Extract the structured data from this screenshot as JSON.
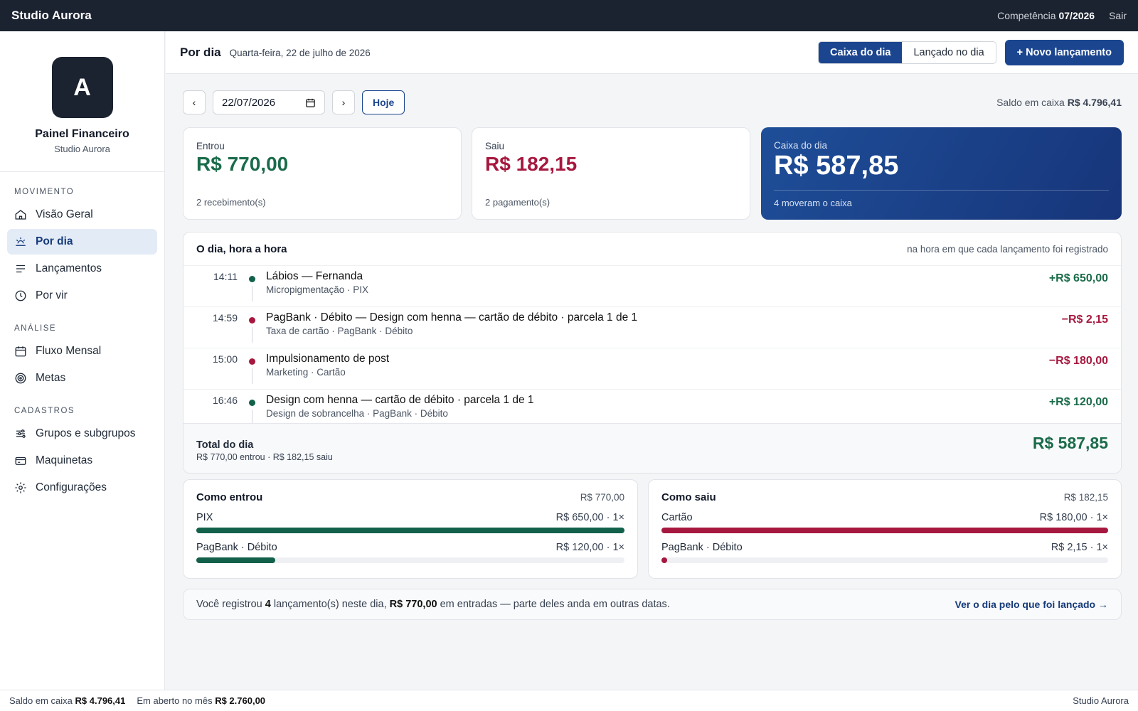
{
  "topbar": {
    "brand": "Studio Aurora",
    "competencia_label": "Competência",
    "competencia_value": "07/2026",
    "logout": "Sair"
  },
  "sidebar": {
    "avatar_letter": "A",
    "profile_name": "Painel Financeiro",
    "profile_sub": "Studio Aurora",
    "sections": [
      {
        "title": "MOVIMENTO",
        "items": [
          {
            "label": "Visão Geral",
            "icon": "home-icon"
          },
          {
            "label": "Por dia",
            "icon": "sunrise-icon",
            "active": true
          },
          {
            "label": "Lançamentos",
            "icon": "list-icon"
          },
          {
            "label": "Por vir",
            "icon": "clock-icon"
          }
        ]
      },
      {
        "title": "ANÁLISE",
        "items": [
          {
            "label": "Fluxo Mensal",
            "icon": "calendar-icon"
          },
          {
            "label": "Metas",
            "icon": "target-icon"
          }
        ]
      },
      {
        "title": "CADASTROS",
        "items": [
          {
            "label": "Grupos e subgrupos",
            "icon": "sliders-icon"
          },
          {
            "label": "Maquinetas",
            "icon": "card-icon"
          },
          {
            "label": "Configurações",
            "icon": "gear-icon"
          }
        ]
      }
    ]
  },
  "header": {
    "title": "Por dia",
    "date": "Quarta-feira, 22 de julho de 2026",
    "seg_caixa": "Caixa do dia",
    "seg_lancado": "Lançado no dia",
    "new_button": "+ Novo lançamento"
  },
  "controls": {
    "prev": "‹",
    "date_value": "22/07/2026",
    "next": "›",
    "today": "Hoje",
    "saldo_label": "Saldo em caixa",
    "saldo_value": "R$ 4.796,41"
  },
  "cards": {
    "entrou": {
      "label": "Entrou",
      "value": "R$ 770,00",
      "foot": "2 recebimento(s)"
    },
    "saiu": {
      "label": "Saiu",
      "value": "R$ 182,15",
      "foot": "2 pagamento(s)"
    },
    "caixa": {
      "label": "Caixa do dia",
      "value": "R$ 587,85",
      "foot": "4 moveram o caixa"
    }
  },
  "timeline": {
    "title": "O dia, hora a hora",
    "note": "na hora em que cada lançamento foi registrado",
    "rows": [
      {
        "time": "14:11",
        "title": "Lábios — Fernanda",
        "sub": "Micropigmentação · PIX",
        "amount": "+R$ 650,00",
        "type": "pos"
      },
      {
        "time": "14:59",
        "title": "PagBank · Débito — Design com henna — cartão de débito · parcela 1 de 1",
        "sub": "Taxa de cartão · PagBank · Débito",
        "amount": "−R$ 2,15",
        "type": "neg"
      },
      {
        "time": "15:00",
        "title": "Impulsionamento de post",
        "sub": "Marketing · Cartão",
        "amount": "−R$ 180,00",
        "type": "neg"
      },
      {
        "time": "16:46",
        "title": "Design com henna — cartão de débito · parcela 1 de 1",
        "sub": "Design de sobrancelha · PagBank · Débito",
        "amount": "+R$ 120,00",
        "type": "pos"
      }
    ],
    "total_title": "Total do dia",
    "total_sub": "R$ 770,00 entrou · R$ 182,15 saiu",
    "total_value": "R$ 587,85"
  },
  "como_entrou": {
    "title": "Como entrou",
    "total": "R$ 770,00",
    "items": [
      {
        "label": "PIX",
        "value": "R$ 650,00 · 1×",
        "fraction": 1.0
      },
      {
        "label": "PagBank · Débito",
        "value": "R$ 120,00 · 1×",
        "fraction": 0.185
      }
    ]
  },
  "como_saiu": {
    "title": "Como saiu",
    "total": "R$ 182,15",
    "items": [
      {
        "label": "Cartão",
        "value": "R$ 180,00 · 1×",
        "fraction": 1.0
      },
      {
        "label": "PagBank · Débito",
        "value": "R$ 2,15 · 1×",
        "fraction": 0.012
      }
    ]
  },
  "info": {
    "text_a": "Você registrou",
    "count": "4",
    "text_b": "lançamento(s) neste dia,",
    "amount": "R$ 770,00",
    "text_c": "em entradas — parte deles anda em outras datas.",
    "link": "Ver o dia pelo que foi lançado →"
  },
  "status": {
    "saldo_label": "Saldo em caixa",
    "saldo_value": "R$ 4.796,41",
    "aberto_label": "Em aberto no mês",
    "aberto_value": "R$ 2.760,00",
    "brand": "Studio Aurora"
  },
  "colors": {
    "accent": "#1b458f",
    "positive": "#1a6b4a",
    "negative": "#a6183f",
    "topbar": "#1b2230"
  }
}
